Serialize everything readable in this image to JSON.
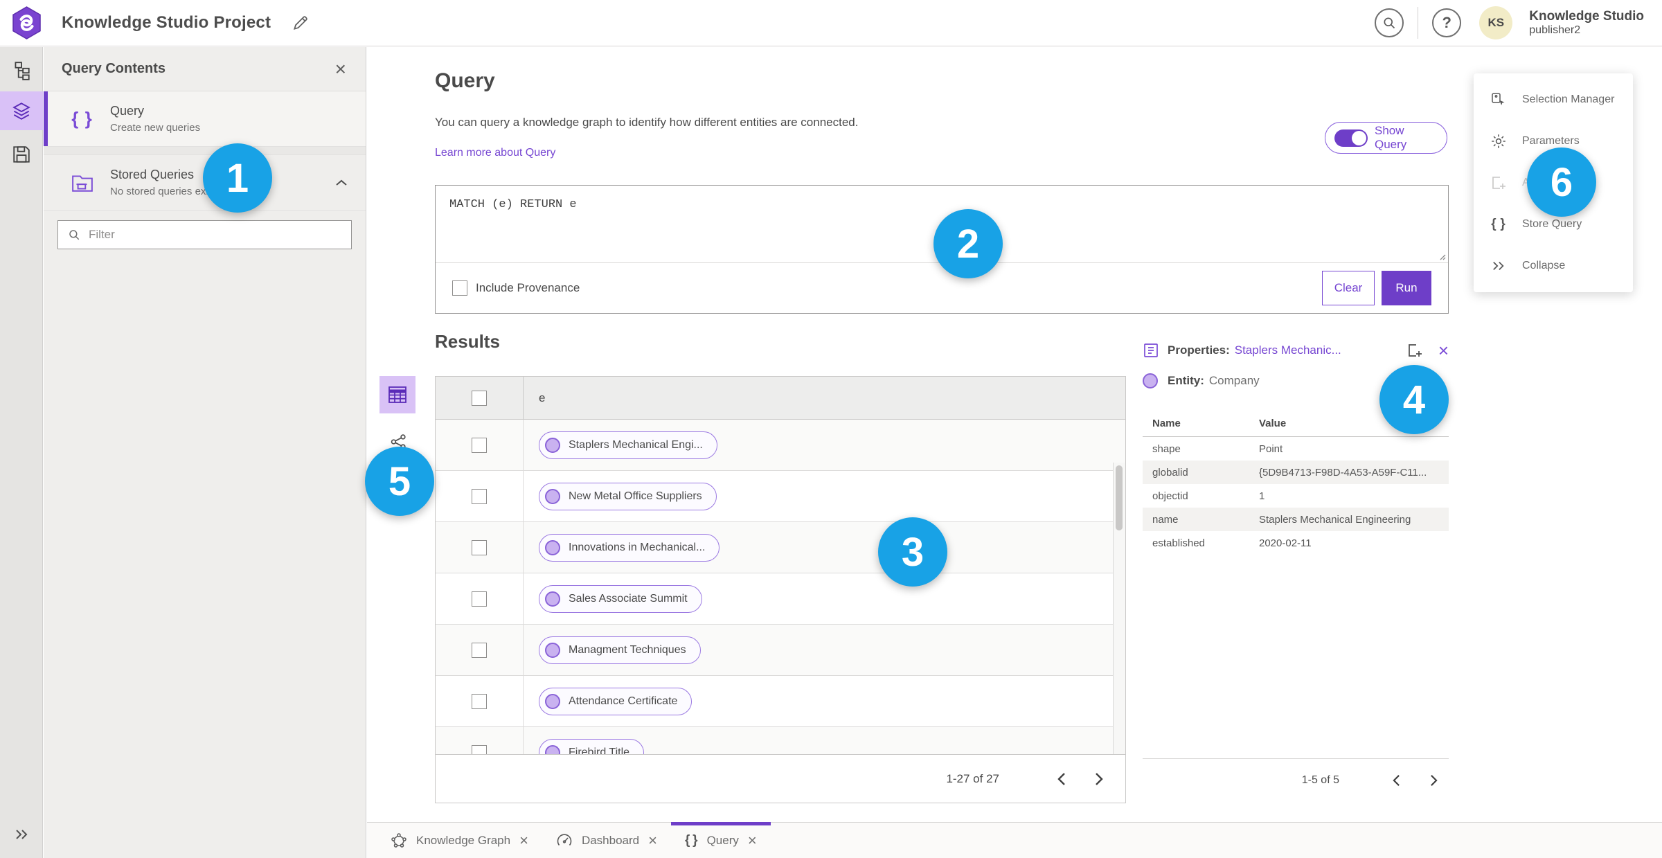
{
  "header": {
    "app_title": "Knowledge Studio Project",
    "avatar_initials": "KS",
    "user_name": "Knowledge Studio",
    "user_role": "publisher2"
  },
  "query_contents": {
    "title": "Query Contents",
    "close_label": "×",
    "items": [
      {
        "label": "Query",
        "description": "Create new queries"
      },
      {
        "label": "Stored Queries",
        "description": "No stored queries exist"
      }
    ],
    "filter_placeholder": "Filter"
  },
  "query_panel": {
    "title": "Query",
    "description": "You can query a knowledge graph to identify how different entities are connected.",
    "link_label": "Learn more about Query",
    "show_query_label": "Show Query",
    "query_text": "MATCH (e) RETURN e",
    "include_provenance_label": "Include Provenance",
    "clear_label": "Clear",
    "run_label": "Run"
  },
  "results": {
    "title": "Results",
    "column_header": "e",
    "rows": [
      "Staplers Mechanical Engi...",
      "New Metal Office Suppliers",
      "Innovations in Mechanical...",
      "Sales Associate Summit",
      "Managment Techniques",
      "Attendance Certificate",
      "Firebird Title"
    ],
    "pagination": {
      "label": "1-27 of 27"
    }
  },
  "properties": {
    "label": "Properties:",
    "entity_link": "Staplers Mechanic...",
    "entity_label": "Entity:",
    "entity_type": "Company",
    "close_label": "×",
    "table": {
      "name_header": "Name",
      "value_header": "Value",
      "rows": [
        {
          "name": "shape",
          "value": "Point"
        },
        {
          "name": "globalid",
          "value": "{5D9B4713-F98D-4A53-A59F-C11..."
        },
        {
          "name": "objectid",
          "value": "1"
        },
        {
          "name": "name",
          "value": "Staplers Mechanical Engineering"
        },
        {
          "name": "established",
          "value": "2020-02-11"
        }
      ]
    },
    "pagination": {
      "label": "1-5 of 5"
    }
  },
  "right_menu": {
    "items": [
      {
        "label": "Selection Manager"
      },
      {
        "label": "Parameters"
      },
      {
        "label": "Add"
      },
      {
        "label": "Store Query"
      },
      {
        "label": "Collapse"
      }
    ]
  },
  "bottom_tabs": [
    {
      "label": "Knowledge Graph"
    },
    {
      "label": "Dashboard"
    },
    {
      "label": "Query"
    }
  ],
  "annotations": [
    "1",
    "2",
    "3",
    "4",
    "5",
    "6"
  ],
  "colors": {
    "accent_purple": "#6e3ec8",
    "link_purple": "#7646d2",
    "annotation_blue": "#18a2e6",
    "rail_selected": "#d9c1f7",
    "avatar_bg": "#f2ecc7",
    "pill_border": "#9b79e2"
  }
}
